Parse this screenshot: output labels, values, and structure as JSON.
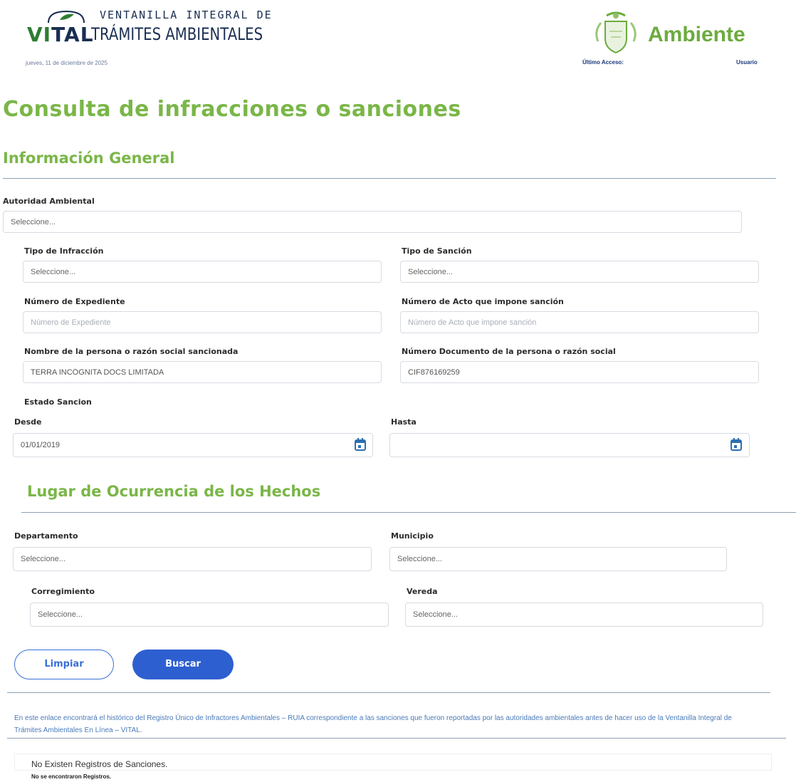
{
  "header": {
    "logo_word_a": "VI",
    "logo_word_b": "TAL",
    "logo_top": "VENTANILLA INTEGRAL DE",
    "logo_bottom": "TRÁMITES AMBIENTALES",
    "date": "jueves, 11 de diciembre de 2025",
    "brand": "Ambiente",
    "last_access": "Último Acceso:",
    "user": "Usuario"
  },
  "page_title": "Consulta de infracciones o sanciones",
  "general": {
    "title": "Información General",
    "autoridad_label": "Autoridad Ambiental",
    "autoridad_value": "Seleccione...",
    "tipo_infraccion_label": "Tipo de Infracción",
    "tipo_infraccion_value": "Seleccione...",
    "tipo_sancion_label": "Tipo de Sanción",
    "tipo_sancion_value": "Seleccione...",
    "expediente_label": "Número de Expediente",
    "expediente_placeholder": "Número de Expediente",
    "acto_label": "Número de Acto que impone sanción",
    "acto_placeholder": "Número de Acto que impone sanción",
    "nombre_label": "Nombre de la persona o razón social sancionada",
    "nombre_value": "TERRA INCÓGNITA DOCS LIMITADA",
    "documento_label": "Número Documento de la persona o razón social",
    "documento_value": "CIF876169259",
    "estado_label": "Estado Sancion",
    "desde_label": "Desde",
    "desde_value": "01/01/2019",
    "hasta_label": "Hasta",
    "hasta_value": ""
  },
  "lugar": {
    "title": "Lugar de Ocurrencia de los Hechos",
    "departamento_label": "Departamento",
    "departamento_value": "Seleccione...",
    "municipio_label": "Municipio",
    "municipio_value": "Seleccione...",
    "corregimiento_label": "Corregimiento",
    "corregimiento_value": "Seleccione...",
    "vereda_label": "Vereda",
    "vereda_value": "Seleccione..."
  },
  "actions": {
    "clear": "Limpiar",
    "search": "Buscar"
  },
  "info_link": "En este enlace encontrará el histórico del Registro Único de Infractores Ambientales – RUIA correspondiente a las sanciones que fueron reportadas por las autoridades ambientales antes de hacer uso de la Ventanilla Integral de Trámites Ambientales En Línea – VITAL.",
  "results": {
    "empty_message": "No Existen Registros de Sanciones.",
    "not_found": "No se encontraron Registros."
  },
  "colors": {
    "green_title": "#7ab648",
    "primary_blue": "#2e5fd0",
    "navy": "#1a2e52"
  }
}
